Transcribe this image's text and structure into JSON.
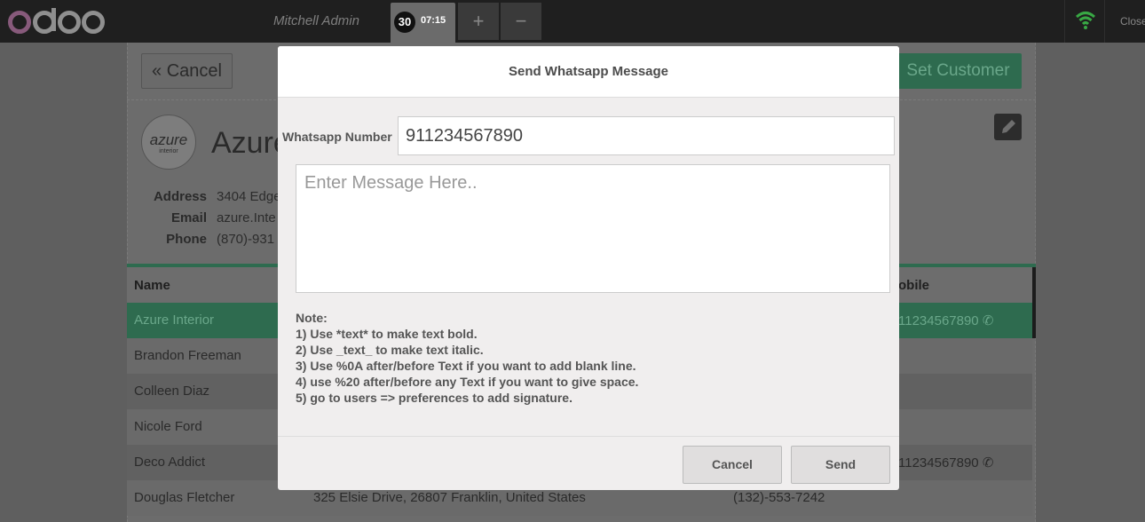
{
  "topbar": {
    "cashier": "Mitchell Admin",
    "order_number": "30",
    "order_time": "07:15",
    "add_label": "+",
    "remove_label": "−",
    "close_label": "Close"
  },
  "background": {
    "cancel_label": "« Cancel",
    "set_customer_label": "Set Customer",
    "avatar_text": "azure",
    "avatar_subtext": "interior",
    "customer_name": "Azure",
    "address_label": "Address",
    "address_value": "3404 Edge",
    "email_label": "Email",
    "email_value": "azure.Inte",
    "phone_label": "Phone",
    "phone_value": "(870)-931",
    "col_name": "Name",
    "col_mobile": "obile",
    "rows": [
      {
        "name": "Azure Interior",
        "mobile": "11234567890 ✆"
      },
      {
        "name": "Brandon Freeman",
        "mobile": ""
      },
      {
        "name": "Colleen Diaz",
        "mobile": ""
      },
      {
        "name": "Nicole Ford",
        "mobile": ""
      },
      {
        "name": "Deco Addict",
        "mobile": "11234567890 ✆"
      },
      {
        "name": "Douglas Fletcher",
        "address": "325 Elsie Drive, 26807 Franklin, United States",
        "phone": "(132)-553-7242"
      }
    ]
  },
  "dialog": {
    "title": "Send Whatsapp Message",
    "number_label": "Whatsapp Number",
    "number_value": "911234567890",
    "message_placeholder": "Enter Message Here..",
    "note_title": "Note:",
    "notes": [
      "1) Use *text* to make text bold.",
      "2) Use _text_ to make text italic.",
      "3) Use %0A after/before Text if you want to add blank line.",
      "4) use %20 after/before any Text if you want to give space.",
      "5) go to users => preferences to add signature."
    ],
    "cancel_label": "Cancel",
    "send_label": "Send"
  },
  "colors": {
    "accent_green": "#2e6b4f",
    "odoo_purple": "#875a7b",
    "wifi_green": "#38a844"
  }
}
